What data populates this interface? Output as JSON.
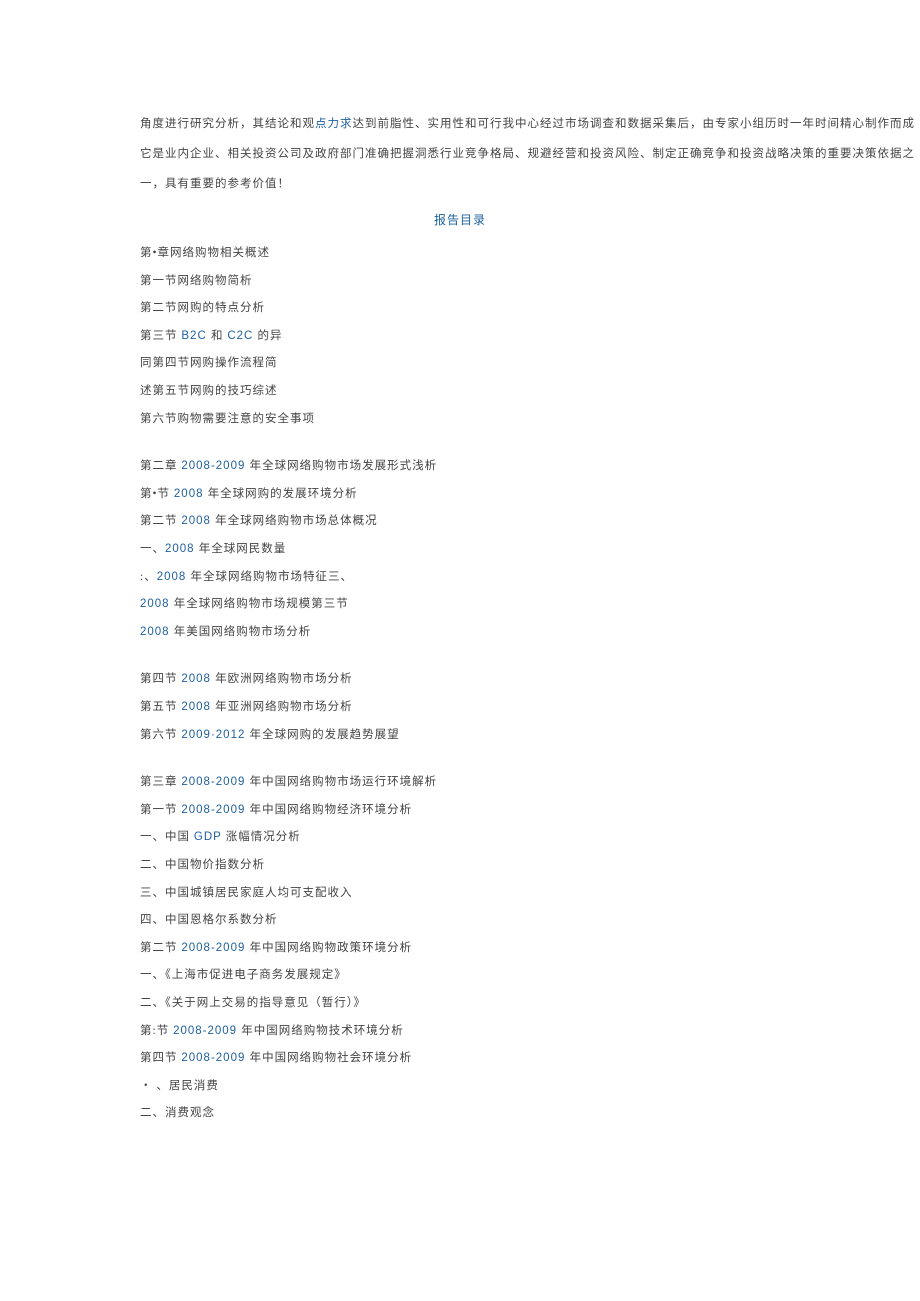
{
  "intro": {
    "line1_a": "角度进行研究分析，其结论和观",
    "line1_b": "点力求",
    "line1_c": "达到前脂性、实用性和可行我中心经过市场调查和数据采集后，由专家小组历时一年时间精心制作而成",
    "line2": "它是业内企业、相关投资公司及政府部门准确把握洞悉行业竞争格局、规避经营和投资风险、制定正确竞争和投资战略决策的重要决策依据之",
    "line3": "一，具有重要的参考价值！"
  },
  "title": "报告目录",
  "ch1": {
    "h": "第•章网络购物相关概述",
    "s1": "第一节网络购物简析",
    "s2": "第二节网购的特点分析",
    "s3_a": "第三节 ",
    "s3_b": "B2C ",
    "s3_c": "和 ",
    "s3_d": "C2C ",
    "s3_e": "的异",
    "s4": "同第四节网购操作流程简",
    "s5": "述第五节网购的技巧综述",
    "s6": "第六节购物需要注意的安全事项"
  },
  "ch2": {
    "h_a": "第二章 ",
    "h_b": "2008-2009 ",
    "h_c": "年全球网络购物市场发展形式浅析",
    "s1_a": "第•节 ",
    "s1_b": "2008 ",
    "s1_c": "年全球网购的发展环境分析",
    "s2_a": "第二节 ",
    "s2_b": "2008 ",
    "s2_c": "年全球网络购物市场总体概况",
    "i1_a": "一、",
    "i1_b": "2008 ",
    "i1_c": "年全球网民数量",
    "i2_a": ":、",
    "i2_b": "2008 ",
    "i2_c": "年全球网络购物市场特征三、",
    "i3_a": "2008 ",
    "i3_b": "年全球网络购物市场规模第三节",
    "i4_a": "2008 ",
    "i4_b": "年美国网络购物市场分析",
    "s4_a": "第四节 ",
    "s4_b": "2008 ",
    "s4_c": "年欧洲网络购物市场分析",
    "s5_a": "第五节 ",
    "s5_b": "2008 ",
    "s5_c": "年亚洲网络购物市场分析",
    "s6_a": "第六节 ",
    "s6_b": "2009·2012 ",
    "s6_c": "年全球网购的发展趋势展望"
  },
  "ch3": {
    "h_a": "第三章 ",
    "h_b": "2008-2009 ",
    "h_c": "年中国网络购物市场运行环境解析",
    "s1_a": "第一节 ",
    "s1_b": "2008-2009 ",
    "s1_c": "年中国网络购物经济环境分析",
    "i1_a": "一、中国 ",
    "i1_b": "GDP ",
    "i1_c": "涨幅情况分析",
    "i2": "二、中国物价指数分析",
    "i3": "三、中国城镇居民家庭人均可支配收入",
    "i4": "四、中国恩格尔系数分析",
    "s2_a": "第二节 ",
    "s2_b": "2008-2009 ",
    "s2_c": "年中国网络购物政策环境分析",
    "i5": "一、《上海市促进电子商务发展规定》",
    "i6": "二、《关于网上交易的指导意见（暂行）》",
    "s3_a": "第:节 ",
    "s3_b": "2008-2009 ",
    "s3_c": "年中国网络购物技术环境分析",
    "s4_a": "第四节 ",
    "s4_b": "2008-2009 ",
    "s4_c": "年中国网络购物社会环境分析",
    "i7": "・ 、居民消费",
    "i8": "二、消费观念"
  }
}
